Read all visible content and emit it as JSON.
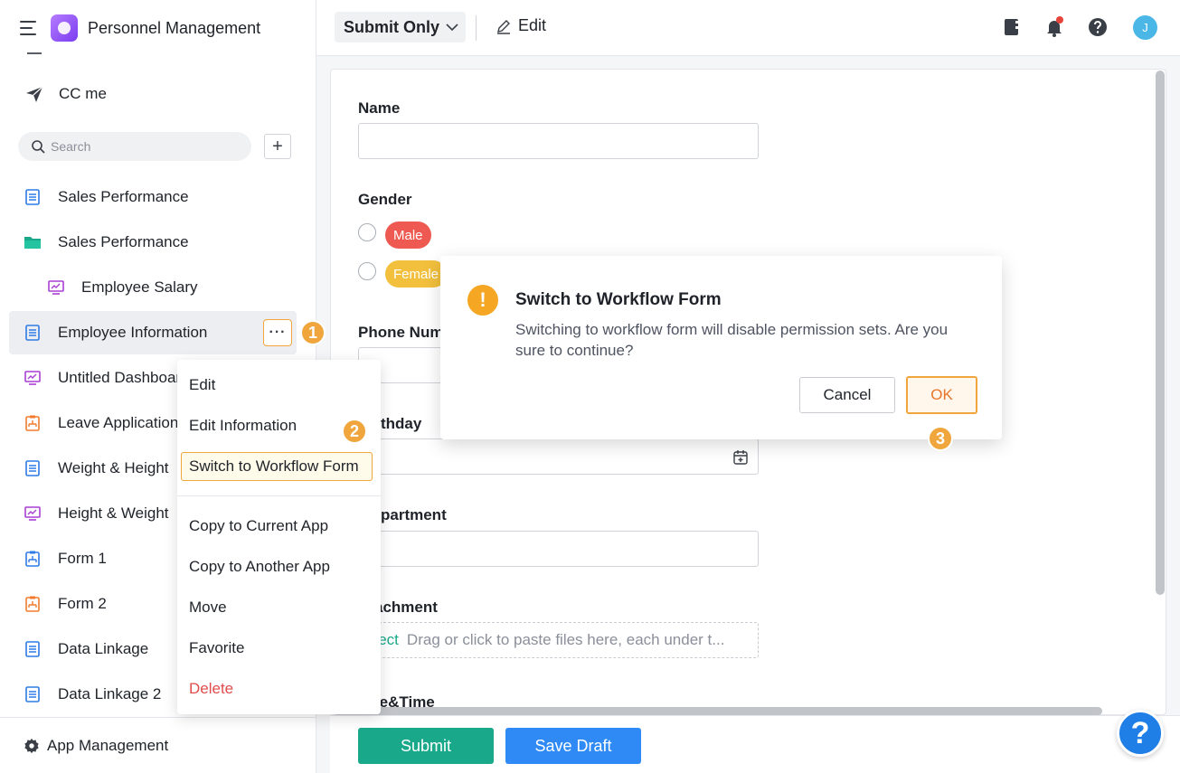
{
  "sidebar": {
    "app_title": "Personnel Management",
    "cc_me": "CC me",
    "search_placeholder": "Search",
    "add_label": "+",
    "items": [
      {
        "label": "Sales Performance",
        "icon": "form-icon"
      },
      {
        "label": "Sales Performance",
        "icon": "folder-icon"
      },
      {
        "label": "Employee Salary",
        "icon": "dashboard-icon"
      },
      {
        "label": "Employee Information",
        "icon": "form-icon"
      },
      {
        "label": "Untitled Dashboard",
        "icon": "dashboard-icon"
      },
      {
        "label": "Leave Application",
        "icon": "workflow-form-icon"
      },
      {
        "label": "Weight & Height",
        "icon": "form-icon"
      },
      {
        "label": "Height & Weight",
        "icon": "dashboard-icon"
      },
      {
        "label": "Form 1",
        "icon": "workflow-form-icon"
      },
      {
        "label": "Form 2",
        "icon": "workflow-form-icon"
      },
      {
        "label": "Data Linkage",
        "icon": "form-icon"
      },
      {
        "label": "Data Linkage 2",
        "icon": "form-icon"
      }
    ],
    "more_label": "···",
    "footer": "App Management"
  },
  "context_menu": {
    "items": [
      "Edit",
      "Edit Information",
      "Switch to Workflow Form",
      "Copy to Current App",
      "Copy to Another App",
      "Move",
      "Favorite",
      "Delete"
    ]
  },
  "steps": [
    "1",
    "2",
    "3"
  ],
  "topbar": {
    "mode": "Submit Only",
    "edit": "Edit",
    "avatar": "J"
  },
  "form": {
    "labels": {
      "name": "Name",
      "gender": "Gender",
      "phone": "Phone Num",
      "birthday": "thday",
      "department": "partment",
      "attachment": "achment",
      "datetime": "te&Time"
    },
    "gender_options": [
      "Male",
      "Female"
    ],
    "upload_select": "elect",
    "upload_hint": "Drag or click to paste files here, each under t..."
  },
  "buttons": {
    "submit": "Submit",
    "save_draft": "Save Draft",
    "help": "?"
  },
  "dialog": {
    "icon": "!",
    "title": "Switch to Workflow Form",
    "message": "Switching to workflow form will disable permission sets. Are you sure to continue?",
    "cancel": "Cancel",
    "ok": "OK"
  },
  "colors": {
    "accent": "#f0a63c",
    "submit": "#19a88a",
    "save_draft": "#2f8af5",
    "male_tag": "#ee5a52",
    "female_tag": "#f3c03d",
    "danger": "#e14c4c"
  }
}
